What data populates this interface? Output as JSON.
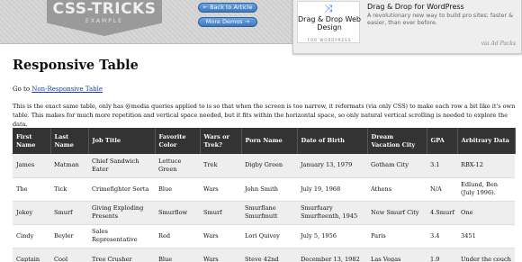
{
  "header": {
    "logo_text": "CSS-TRICKS",
    "logo_sub": "EXAMPLE",
    "back_button": "← Back to Article",
    "more_demos_button": "More Demos →"
  },
  "ad": {
    "book_title": "Drag & Drop Web Design",
    "book_sub": "FOR WORDPRESS",
    "title": "Drag & Drop for WordPress",
    "description": "A revolutionary new way to build pro sites; faster & easier, than ever before.",
    "via": "via Ad Packs"
  },
  "page": {
    "title": "Responsive Table",
    "goto_prefix": "Go to ",
    "goto_link": "Non-Responsive Table",
    "description": "This is the exact same table, only has @media queries applied to is so that when the screen is too narrow, it reformats (via only CSS) to make each row a bit like it's own table. This makes for much more repetition and vertical space needed, but it fits within the horizontal space, so only natural vertical scrolling is needed to explore the data."
  },
  "table": {
    "headers": [
      "First Name",
      "Last Name",
      "Job Title",
      "Favorite Color",
      "Wars or Trek?",
      "Porn Name",
      "Date of Birth",
      "Dream Vacation City",
      "GPA",
      "Arbitrary Data"
    ],
    "rows": [
      [
        "James",
        "Matman",
        "Chief Sandwich Eater",
        "Lettuce Green",
        "Trek",
        "Digby Green",
        "January 13, 1979",
        "Gotham City",
        "3.1",
        "RBX-12"
      ],
      [
        "The",
        "Tick",
        "Crimefighter Sorta",
        "Blue",
        "Wars",
        "John Smith",
        "July 19, 1968",
        "Athens",
        "N/A",
        "Edlund, Ben (July 1996)."
      ],
      [
        "Jokey",
        "Smurf",
        "Giving Exploding Presents",
        "Smurflow",
        "Smurf",
        "Smurflane Smurfmutt",
        "Smurfuary Smurfteenth, 1945",
        "New Smurf City",
        "4.Smurf",
        "One"
      ],
      [
        "Cindy",
        "Beyler",
        "Sales Representative",
        "Red",
        "Wars",
        "Lori Quivey",
        "July 5, 1956",
        "Paris",
        "3.4",
        "3451"
      ],
      [
        "Captain",
        "Cool",
        "Tree Crusher",
        "Blue",
        "Wars",
        "Steve 42nd",
        "December 13, 1982",
        "Las Vegas",
        "1.9",
        "Under the couch"
      ]
    ]
  }
}
